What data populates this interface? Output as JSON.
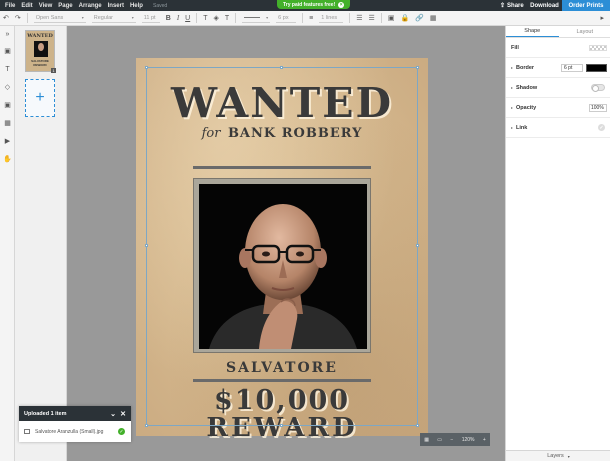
{
  "menubar": {
    "items": [
      "File",
      "Edit",
      "View",
      "Page",
      "Arrange",
      "Insert",
      "Help"
    ],
    "status": "Saved",
    "promo": "Try paid features free!",
    "promo_close": "×",
    "share_label": "Share",
    "download_label": "Download",
    "order_label": "Order Prints"
  },
  "toolbar": {
    "font": "Open Sans",
    "weight": "Regular",
    "size": "11 pt",
    "bold": "B",
    "italic": "I",
    "underline": "U",
    "stroke_size": "6 px",
    "line_spacing": "1 lines",
    "caret": "▾"
  },
  "icons": {
    "undo": "↶",
    "redo": "↷",
    "expand": "»",
    "text": "T",
    "shapes": "◇",
    "image": "▣",
    "grid": "▦",
    "video": "▶",
    "hand": "✋",
    "align": "≡",
    "fill": "◈",
    "list": "☰",
    "lock": "🔒",
    "link": "🔗",
    "collapse": "▸",
    "check": "✓"
  },
  "pages": {
    "thumb_title": "WANTED",
    "thumb_caption": "SALVATORE REWARD",
    "page_number": "1",
    "add_symbol": "+"
  },
  "poster": {
    "headline": "WANTED",
    "for_word": "for",
    "crime": "BANK ROBBERY",
    "name": "SALVATORE",
    "amount": "$10,000",
    "reward": "REWARD"
  },
  "zoom": {
    "value": "120%",
    "minus": "−",
    "plus": "+"
  },
  "right_panel": {
    "tabs": [
      "Shape",
      "Layout"
    ],
    "fill_label": "Fill",
    "border_label": "Border",
    "border_size": "6 pt",
    "border_color": "#000000",
    "shadow_label": "Shadow",
    "opacity_label": "Opacity",
    "opacity_value": "100%",
    "link_label": "Link",
    "layers_label": "Layers"
  },
  "upload": {
    "title": "Uploaded 1 item",
    "minimize": "⌄",
    "close": "✕",
    "filename": "Salvatore Aranzulla (Small).jpg"
  },
  "colors": {
    "accent": "#2c8ed6",
    "success": "#43b02a",
    "menubar_bg": "#2b3237",
    "poster_bg": "#d9bd93"
  }
}
